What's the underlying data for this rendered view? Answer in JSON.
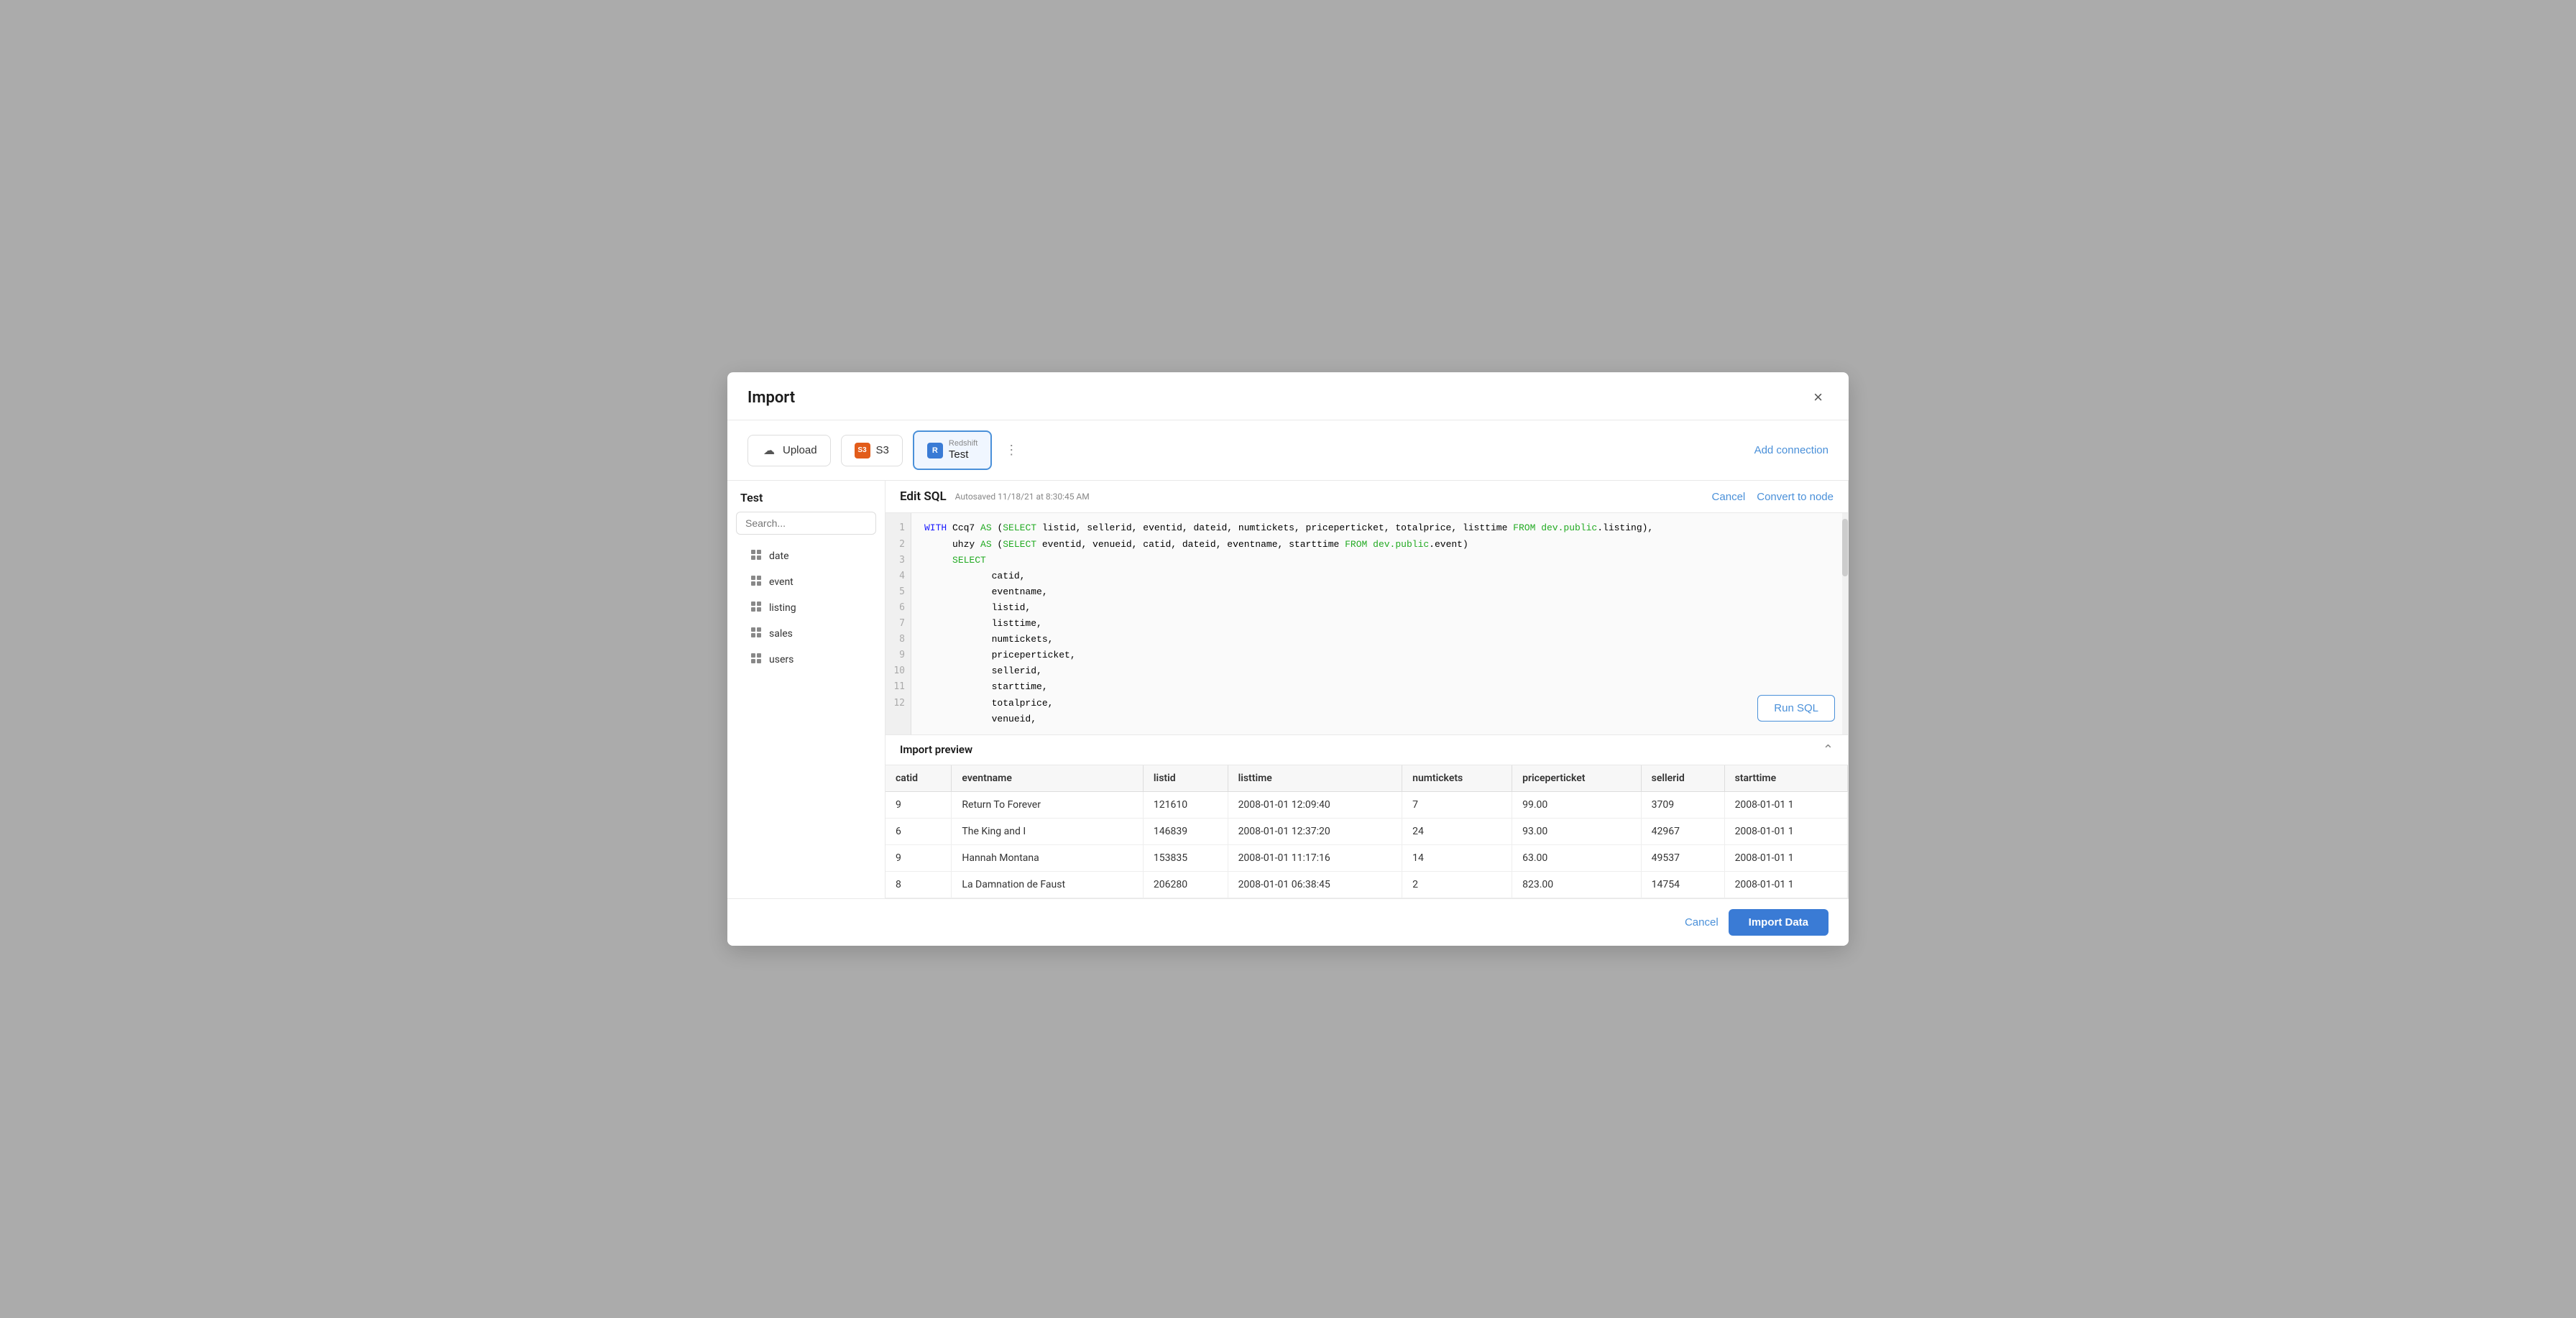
{
  "modal": {
    "title": "Import",
    "close_label": "×"
  },
  "connections": {
    "upload_label": "Upload",
    "s3_label": "S3",
    "redshift_label": "Redshift",
    "redshift_name": "Test",
    "add_connection_label": "Add connection"
  },
  "sidebar": {
    "title": "Test",
    "search_placeholder": "Search...",
    "tables": [
      {
        "name": "date"
      },
      {
        "name": "event"
      },
      {
        "name": "listing"
      },
      {
        "name": "sales"
      },
      {
        "name": "users"
      }
    ]
  },
  "sql_editor": {
    "title": "Edit SQL",
    "autosaved": "Autosaved 11/18/21 at 8:30:45 AM",
    "cancel_label": "Cancel",
    "convert_label": "Convert to node",
    "run_label": "Run SQL",
    "lines": [
      1,
      2,
      3,
      4,
      5,
      6,
      7,
      8,
      9,
      10,
      11,
      12
    ],
    "code_lines": [
      "WITH Ccq7 AS (SELECT listid, sellerid, eventid, dateid, numtickets, priceperticket, totalprice, listtime FROM dev.public.listing),",
      "     uhzy AS (SELECT eventid, venueid, catid, dateid, eventname, starttime FROM dev.public.event)",
      "     SELECT",
      "            catid,",
      "            eventname,",
      "            listid,",
      "            listtime,",
      "            numtickets,",
      "            priceperticket,",
      "            sellerid,",
      "            starttime,",
      "            totalprice,"
    ]
  },
  "preview": {
    "title": "Import preview",
    "collapse_icon": "chevron-up",
    "columns": [
      "catid",
      "eventname",
      "listid",
      "listtime",
      "numtickets",
      "priceperticket",
      "sellerid",
      "starttime"
    ],
    "rows": [
      {
        "catid": "9",
        "eventname": "Return To Forever",
        "listid": "121610",
        "listtime": "2008-01-01 12:09:40",
        "numtickets": "7",
        "priceperticket": "99.00",
        "sellerid": "3709",
        "starttime": "2008-01-01 1"
      },
      {
        "catid": "6",
        "eventname": "The King and I",
        "listid": "146839",
        "listtime": "2008-01-01 12:37:20",
        "numtickets": "24",
        "priceperticket": "93.00",
        "sellerid": "42967",
        "starttime": "2008-01-01 1"
      },
      {
        "catid": "9",
        "eventname": "Hannah Montana",
        "listid": "153835",
        "listtime": "2008-01-01 11:17:16",
        "numtickets": "14",
        "priceperticket": "63.00",
        "sellerid": "49537",
        "starttime": "2008-01-01 1"
      },
      {
        "catid": "8",
        "eventname": "La Damnation de Faust",
        "listid": "206280",
        "listtime": "2008-01-01 06:38:45",
        "numtickets": "2",
        "priceperticket": "823.00",
        "sellerid": "14754",
        "starttime": "2008-01-01 1"
      }
    ]
  },
  "footer": {
    "cancel_label": "Cancel",
    "import_label": "Import Data"
  }
}
